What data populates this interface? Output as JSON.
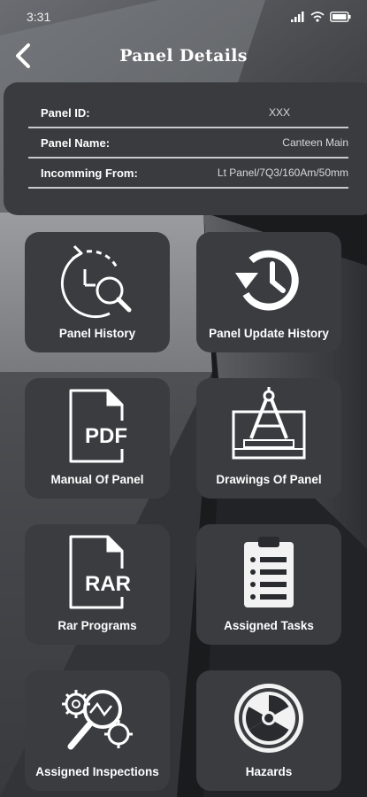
{
  "status_bar": {
    "time": "3:31"
  },
  "header": {
    "title": "Panel Details"
  },
  "panel_info": [
    {
      "label": "Panel ID:",
      "value": "XXX"
    },
    {
      "label": "Panel Name:",
      "value": "Canteen Main"
    },
    {
      "label": "Incomming From:",
      "value": "Lt Panel/7Q3/160Am/50mm"
    }
  ],
  "tiles": [
    {
      "label": "Panel History",
      "icon": "history-search-icon"
    },
    {
      "label": "Panel Update History",
      "icon": "clock-history-icon"
    },
    {
      "label": "Manual Of Panel",
      "icon": "pdf-file-icon"
    },
    {
      "label": "Drawings Of Panel",
      "icon": "drawing-compass-icon"
    },
    {
      "label": "Rar Programs",
      "icon": "rar-file-icon"
    },
    {
      "label": "Assigned Tasks",
      "icon": "clipboard-list-icon"
    },
    {
      "label": "Assigned Inspections",
      "icon": "gear-magnifier-icon"
    },
    {
      "label": "Hazards",
      "icon": "radiation-icon"
    }
  ],
  "colors": {
    "tile_bg": "#3a3c40",
    "card_bg": "#393b3f",
    "page_bg": "#1c1d1f",
    "text": "#ffffff"
  }
}
